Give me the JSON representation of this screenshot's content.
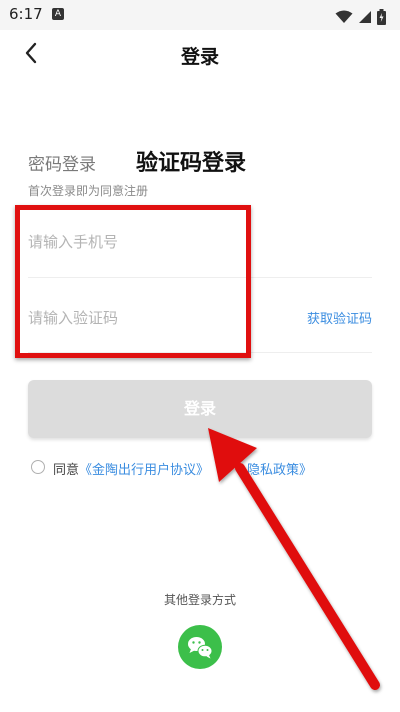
{
  "status_bar": {
    "time": "6:17",
    "notification_badge": "A"
  },
  "header": {
    "title": "登录",
    "back_icon": "chevron-left-icon"
  },
  "tabs": {
    "password_login": "密码登录",
    "sms_login": "验证码登录"
  },
  "hint": "首次登录即为同意注册",
  "form": {
    "phone_placeholder": "请输入手机号",
    "phone_value": "",
    "code_placeholder": "请输入验证码",
    "code_value": "",
    "get_code_label": "获取验证码"
  },
  "login_button_label": "登录",
  "agreement": {
    "prefix": "同意",
    "user_agreement_link": "《金陶出行用户协议》",
    "connector": "",
    "privacy_link": "隐私政策》"
  },
  "other_login": {
    "label": "其他登录方式",
    "wechat_icon": "wechat-icon"
  },
  "colors": {
    "accent_link": "#3b8de0",
    "wechat_green": "#3cbf4a",
    "annotation_red": "#e01010",
    "disabled_button": "#dcdcdc"
  }
}
